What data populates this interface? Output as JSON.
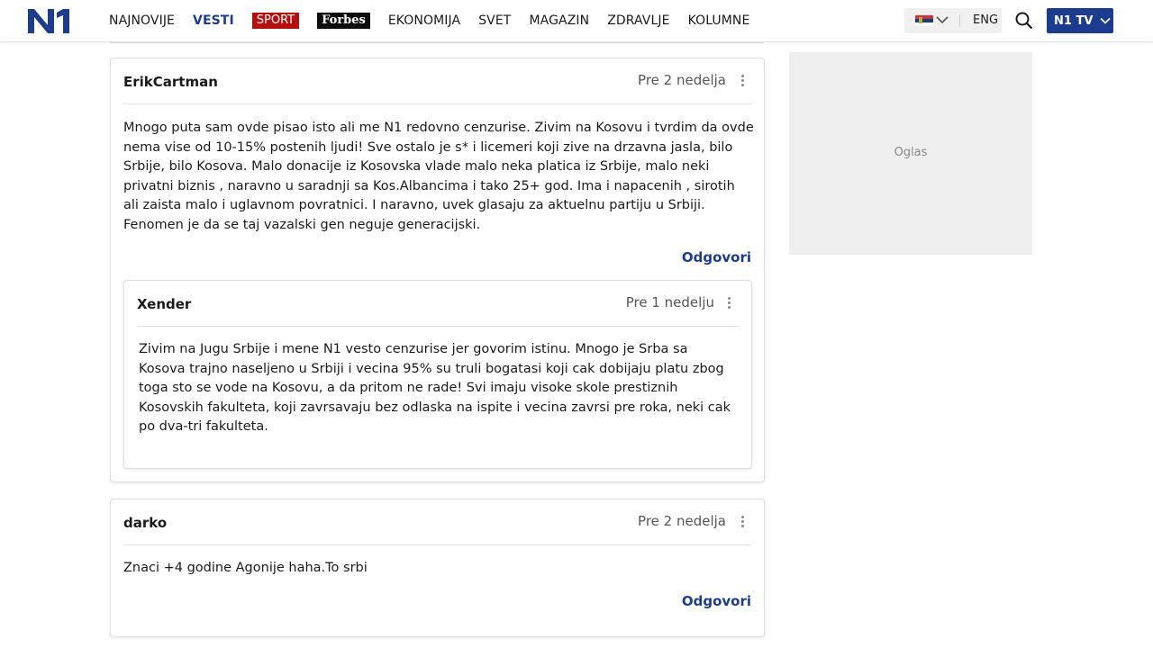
{
  "header": {
    "logo_text": "N1",
    "nav": {
      "najnovije": "NAJNOVIJE",
      "vesti": "VESTI",
      "sport": "SPORT",
      "forbes": "Forbes",
      "ekonomija": "EKONOMIJA",
      "svet": "SVET",
      "magazin": "MAGAZIN",
      "zdravlje": "ZDRAVLJE",
      "kolumne": "KOLUMNE"
    },
    "language_alt": "ENG",
    "tv_button": "N1 TV"
  },
  "colors": {
    "brand_blue": "#1c3c8f",
    "sport_red": "#b3100d",
    "forbes_black": "#0d0d0d"
  },
  "comments": [
    {
      "author": "ErikCartman",
      "time": "Pre 2 nedelja",
      "text": "Mnogo puta sam ovde pisao isto ali me N1 redovno cenzurise. Zivim na Kosovu i tvrdim da ovde nema vise od 10-15% postenih ljudi! Sve ostalo je s* i licemeri koji zive na drzavna jasla, bilo Srbije, bilo Kosova. Malo donacije iz Kosovska vlade malo neka platica iz Srbije, malo neki privatni biznis , naravno u saradnji sa Kos.Albancima i tako 25+ god. Ima i napacenih , sirotih ali zaista malo i uglavnom povratnici. I naravno, uvek glasaju za aktuelnu partiju u Srbiji. Fenomen je da se taj vazalski gen neguje generacijski.",
      "reply_label": "Odgovori",
      "replies": [
        {
          "author": "Xender",
          "time": "Pre 1 nedelju",
          "text": "Zivim na Jugu Srbije i mene N1 vesto cenzurise jer govorim istinu. Mnogo je Srba sa Kosova trajno naseljeno u Srbiji i vecina 95% su truli bogatasi koji cak dobijaju platu zbog toga sto se vode na Kosovu, a da pritom ne rade! Svi imaju visoke skole prestiznih Kosovskih fakulteta, koji zavrsavaju bez odlaska na ispite i vecina zavrsi pre roka, neki cak po dva-tri fakulteta."
        }
      ]
    },
    {
      "author": "darko",
      "time": "Pre 2 nedelja",
      "text": "Znaci +4 godine Agonije haha.To srbi",
      "reply_label": "Odgovori"
    }
  ],
  "sidebar": {
    "ad_label": "Oglas"
  }
}
